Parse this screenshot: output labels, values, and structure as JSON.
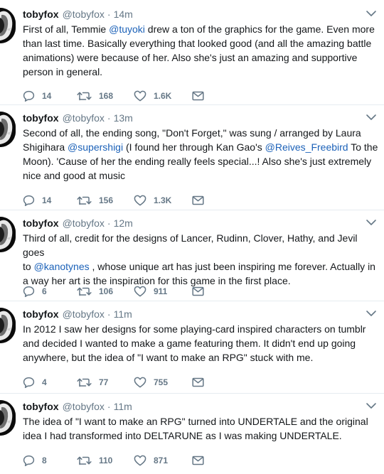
{
  "tweets": [
    {
      "name": "tobyfox",
      "handle": "@tobyfox",
      "sep": "·",
      "time": "14m",
      "lines": [
        [
          {
            "t": "First of all, Temmie "
          },
          {
            "t": "@tuyoki",
            "m": true
          },
          {
            "t": " drew a ton of the graphics for the game. Even more"
          }
        ],
        [
          {
            "t": "than last time. Basically everything that looked good (and all the amazing battle"
          }
        ],
        [
          {
            "t": "animations) were because of her. Also she's just an amazing and supportive"
          }
        ],
        [
          {
            "t": "person in general."
          }
        ]
      ],
      "replies": "14",
      "retweets": "168",
      "likes": "1.6K"
    },
    {
      "name": "tobyfox",
      "handle": "@tobyfox",
      "sep": "·",
      "time": "13m",
      "lines": [
        [
          {
            "t": "Second of all, the ending song, \"Don't Forget,\" was sung / arranged by Laura"
          }
        ],
        [
          {
            "t": "Shigihara "
          },
          {
            "t": "@supershigi",
            "m": true
          },
          {
            "t": " (I found her through Kan Gao's "
          },
          {
            "t": "@Reives_Freebird",
            "m": true
          },
          {
            "t": " To the"
          }
        ],
        [
          {
            "t": "Moon). 'Cause of her the ending really feels special...! Also she's just extremely"
          }
        ],
        [
          {
            "t": "nice and good at music"
          }
        ]
      ],
      "replies": "14",
      "retweets": "156",
      "likes": "1.3K"
    },
    {
      "name": "tobyfox",
      "handle": "@tobyfox",
      "sep": "·",
      "time": "12m",
      "lines": [
        [
          {
            "t": "Third of all, credit for the designs of Lancer, Rudinn, Clover, Hathy, and Jevil goes"
          }
        ],
        [
          {
            "t": "to "
          },
          {
            "t": "@kanotynes",
            "m": true
          },
          {
            "t": " , whose unique art has just been inspiring me forever. Actually in"
          }
        ],
        [
          {
            "t": "a way her art is the inspiration for this game in the first place."
          }
        ]
      ],
      "replies": "6",
      "retweets": "106",
      "likes": "911"
    },
    {
      "name": "tobyfox",
      "handle": "@tobyfox",
      "sep": "·",
      "time": "11m",
      "lines": [
        [
          {
            "t": "In 2012 I saw her designs for some playing-card inspired characters on tumblr"
          }
        ],
        [
          {
            "t": "and decided I wanted to make a game featuring them. It didn't end up going"
          }
        ],
        [
          {
            "t": "anywhere, but the idea of \"I want to make an RPG\" stuck with me."
          }
        ]
      ],
      "replies": "4",
      "retweets": "77",
      "likes": "755"
    },
    {
      "name": "tobyfox",
      "handle": "@tobyfox",
      "sep": "·",
      "time": "11m",
      "lines": [
        [
          {
            "t": "The idea of \"I want to make an RPG\" turned into UNDERTALE and the original"
          }
        ],
        [
          {
            "t": "idea I had transformed into DELTARUNE as I was making UNDERTALE."
          }
        ]
      ],
      "replies": "8",
      "retweets": "110",
      "likes": "871"
    }
  ],
  "icons": {
    "avatar": "avatar-image",
    "caret": "chevron-down-icon",
    "reply": "reply-icon",
    "retweet": "retweet-icon",
    "like": "heart-icon",
    "dm": "envelope-icon"
  },
  "colors": {
    "text": "#14171a",
    "muted": "#657786",
    "mention": "#1b61b8",
    "divider": "#e6ecf0"
  }
}
